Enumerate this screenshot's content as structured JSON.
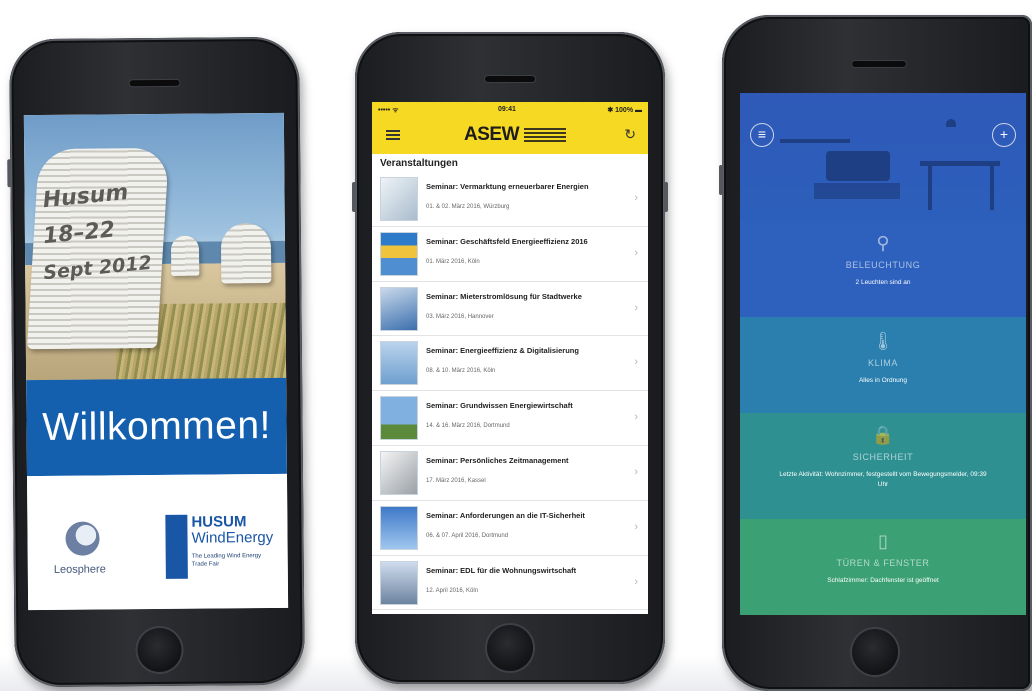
{
  "phone1": {
    "poster_lines": [
      "Husum",
      "18–22",
      "Sept 2012"
    ],
    "welcome": "Willkommen!",
    "sponsor_left": "Leosphere",
    "sponsor_right": {
      "line1": "HUSUM",
      "line2": "WindEnergy",
      "tagline": "The Leading Wind Energy Trade Fair"
    }
  },
  "phone2": {
    "status": {
      "carrier": "••••• ᯤ",
      "time": "09:41",
      "battery": "✱ 100% ▬"
    },
    "header": {
      "logo": "ASEW",
      "menu_icon": "hamburger-icon",
      "refresh_icon": "refresh-icon",
      "bg_color": "#f6d923"
    },
    "section_title": "Veranstaltungen",
    "events": [
      {
        "title": "Seminar: Vermarktung erneuerbarer Energien",
        "meta": "01. & 02. März 2016, Würzburg"
      },
      {
        "title": "Seminar: Geschäftsfeld Energieeffizienz 2016",
        "meta": "01. März 2016, Köln"
      },
      {
        "title": "Seminar: Mieterstromlösung für Stadtwerke",
        "meta": "03. März 2016, Hannover"
      },
      {
        "title": "Seminar: Energieeffizienz & Digitalisierung",
        "meta": "08. & 10. März 2016, Köln"
      },
      {
        "title": "Seminar: Grundwissen Energiewirtschaft",
        "meta": "14. & 16. März 2016, Dortmund"
      },
      {
        "title": "Seminar: Persönliches Zeitmanagement",
        "meta": "17. März 2016, Kassel"
      },
      {
        "title": "Seminar: Anforderungen an die IT-Sicherheit",
        "meta": "06. & 07. April 2016, Dortmund"
      },
      {
        "title": "Seminar: EDL für die Wohnungswirtschaft",
        "meta": "12. April 2016, Köln"
      }
    ]
  },
  "phone3": {
    "top_left_icon": "menu-icon",
    "top_right_icon": "plus-icon",
    "sections": [
      {
        "icon": "lightbulb-icon",
        "glyph": "⚲",
        "title": "BELEUCHTUNG",
        "status": "2 Leuchten sind an",
        "color": "#2d61bd"
      },
      {
        "icon": "thermometer-icon",
        "glyph": "🌡",
        "title": "KLIMA",
        "status": "Alles in Ordnung",
        "color": "#2a7fae"
      },
      {
        "icon": "lock-icon",
        "glyph": "🔒",
        "title": "SICHERHEIT",
        "status": "Letzte Aktivität: Wohnzimmer, festgestellt vom Bewegungsmelder, 09:39 Uhr",
        "color": "#2f9092"
      },
      {
        "icon": "door-icon",
        "glyph": "▯",
        "title": "TÜREN & FENSTER",
        "status": "Schlafzimmer: Dachfenster ist geöffnet",
        "color": "#3ba074"
      }
    ]
  }
}
